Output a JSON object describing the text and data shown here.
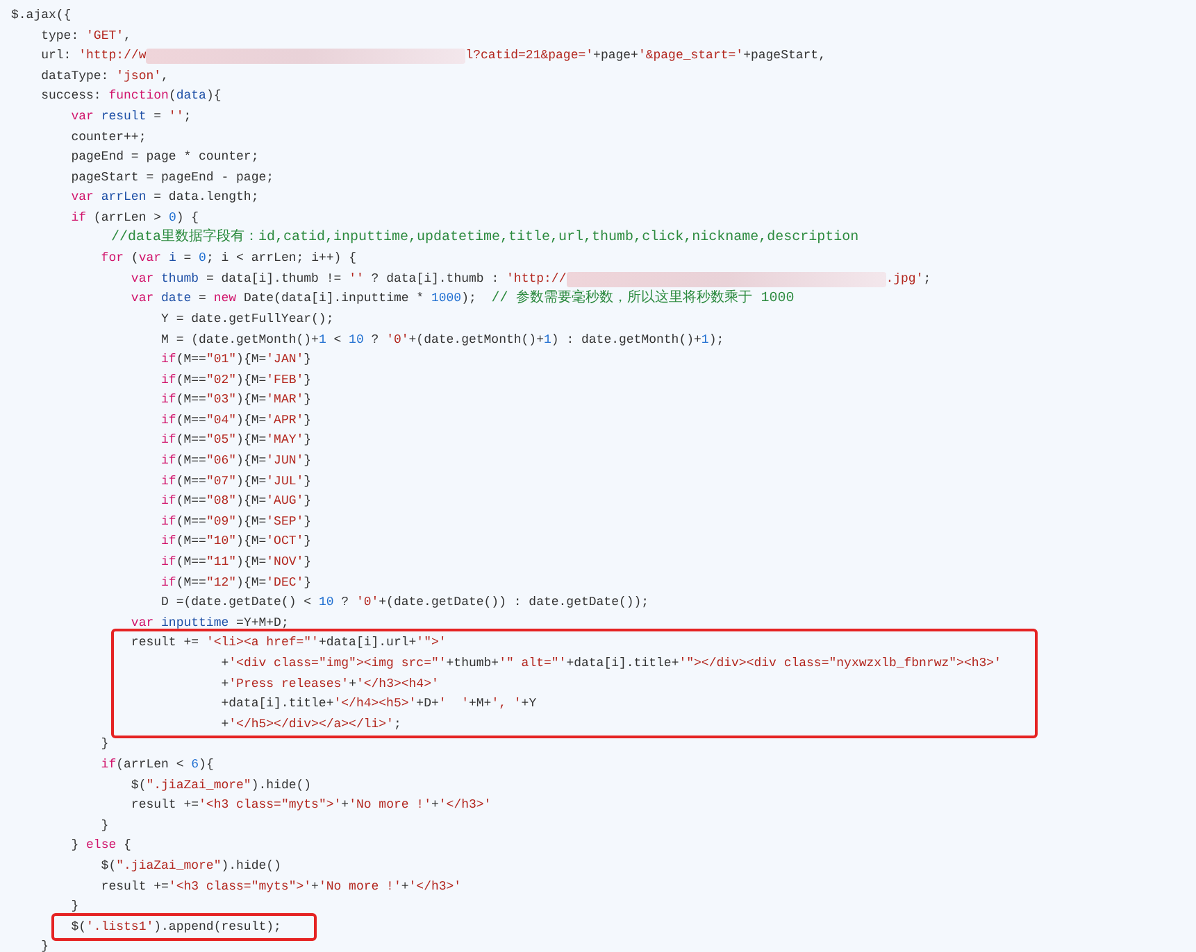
{
  "blocks": [
    {
      "highlighted": false,
      "lines": [
        [
          {
            "kind": "plain",
            "text": "$.ajax({"
          }
        ],
        [
          {
            "kind": "plain",
            "text": "    type: "
          },
          {
            "kind": "string",
            "text": "'GET'"
          },
          {
            "kind": "plain",
            "text": ","
          }
        ],
        [
          {
            "kind": "plain",
            "text": "    url: "
          },
          {
            "kind": "string",
            "text": "'http://w"
          },
          {
            "kind": "redacted"
          },
          {
            "kind": "string",
            "text": "l?catid=21&page='"
          },
          {
            "kind": "plain",
            "text": "+page+"
          },
          {
            "kind": "string",
            "text": "'&page_start='"
          },
          {
            "kind": "plain",
            "text": "+pageStart,"
          }
        ],
        [
          {
            "kind": "plain",
            "text": "    dataType: "
          },
          {
            "kind": "string",
            "text": "'json'"
          },
          {
            "kind": "plain",
            "text": ","
          }
        ],
        [
          {
            "kind": "plain",
            "text": "    success: "
          },
          {
            "kind": "keyword",
            "text": "function"
          },
          {
            "kind": "plain",
            "text": "("
          },
          {
            "kind": "name",
            "text": "data"
          },
          {
            "kind": "plain",
            "text": "){"
          }
        ],
        [
          {
            "kind": "keyword",
            "text": "        var "
          },
          {
            "kind": "name",
            "text": "result"
          },
          {
            "kind": "plain",
            "text": " = "
          },
          {
            "kind": "string",
            "text": "''"
          },
          {
            "kind": "plain",
            "text": ";"
          }
        ],
        [
          {
            "kind": "plain",
            "text": "        counter++;"
          }
        ],
        [
          {
            "kind": "plain",
            "text": "        pageEnd = page * counter;"
          }
        ],
        [
          {
            "kind": "plain",
            "text": "        pageStart = pageEnd - page;"
          }
        ],
        [
          {
            "kind": "keyword",
            "text": "        var "
          },
          {
            "kind": "name",
            "text": "arrLen"
          },
          {
            "kind": "plain",
            "text": " = data.length;"
          }
        ],
        [
          {
            "kind": "keyword",
            "text": "        if"
          },
          {
            "kind": "plain",
            "text": " (arrLen > "
          },
          {
            "kind": "number",
            "text": "0"
          },
          {
            "kind": "plain",
            "text": ") {"
          }
        ],
        [
          {
            "kind": "comment",
            "text": "            //data里数据字段有：id,catid,inputtime,updatetime,title,url,thumb,click,nickname,description"
          }
        ],
        [
          {
            "kind": "keyword",
            "text": "            for"
          },
          {
            "kind": "plain",
            "text": " ("
          },
          {
            "kind": "keyword",
            "text": "var "
          },
          {
            "kind": "name",
            "text": "i"
          },
          {
            "kind": "plain",
            "text": " = "
          },
          {
            "kind": "number",
            "text": "0"
          },
          {
            "kind": "plain",
            "text": "; i < arrLen; i++) {"
          }
        ],
        [
          {
            "kind": "keyword",
            "text": "                var "
          },
          {
            "kind": "name",
            "text": "thumb"
          },
          {
            "kind": "plain",
            "text": " = data[i].thumb != "
          },
          {
            "kind": "string",
            "text": "''"
          },
          {
            "kind": "plain",
            "text": " ? data[i].thumb : "
          },
          {
            "kind": "string",
            "text": "'http://"
          },
          {
            "kind": "redacted"
          },
          {
            "kind": "string",
            "text": ".jpg'"
          },
          {
            "kind": "plain",
            "text": ";"
          }
        ],
        [
          {
            "kind": "keyword",
            "text": "                var "
          },
          {
            "kind": "name",
            "text": "date"
          },
          {
            "kind": "plain",
            "text": " = "
          },
          {
            "kind": "keyword",
            "text": "new"
          },
          {
            "kind": "plain",
            "text": " Date(data[i].inputtime * "
          },
          {
            "kind": "number",
            "text": "1000"
          },
          {
            "kind": "plain",
            "text": ");  "
          },
          {
            "kind": "comment",
            "text": "// 参数需要毫秒数，所以这里将秒数乘于 1000"
          }
        ],
        [
          {
            "kind": "plain",
            "text": "                    Y = date.getFullYear();"
          }
        ],
        [
          {
            "kind": "plain",
            "text": "                    M = (date.getMonth()+"
          },
          {
            "kind": "number",
            "text": "1"
          },
          {
            "kind": "plain",
            "text": " < "
          },
          {
            "kind": "number",
            "text": "10"
          },
          {
            "kind": "plain",
            "text": " ? "
          },
          {
            "kind": "string",
            "text": "'0'"
          },
          {
            "kind": "plain",
            "text": "+(date.getMonth()+"
          },
          {
            "kind": "number",
            "text": "1"
          },
          {
            "kind": "plain",
            "text": ") : date.getMonth()+"
          },
          {
            "kind": "number",
            "text": "1"
          },
          {
            "kind": "plain",
            "text": ");"
          }
        ],
        [
          {
            "kind": "keyword",
            "text": "                    if"
          },
          {
            "kind": "plain",
            "text": "(M=="
          },
          {
            "kind": "string",
            "text": "\"01\""
          },
          {
            "kind": "plain",
            "text": "){M="
          },
          {
            "kind": "string",
            "text": "'JAN'"
          },
          {
            "kind": "plain",
            "text": "}"
          }
        ],
        [
          {
            "kind": "keyword",
            "text": "                    if"
          },
          {
            "kind": "plain",
            "text": "(M=="
          },
          {
            "kind": "string",
            "text": "\"02\""
          },
          {
            "kind": "plain",
            "text": "){M="
          },
          {
            "kind": "string",
            "text": "'FEB'"
          },
          {
            "kind": "plain",
            "text": "}"
          }
        ],
        [
          {
            "kind": "keyword",
            "text": "                    if"
          },
          {
            "kind": "plain",
            "text": "(M=="
          },
          {
            "kind": "string",
            "text": "\"03\""
          },
          {
            "kind": "plain",
            "text": "){M="
          },
          {
            "kind": "string",
            "text": "'MAR'"
          },
          {
            "kind": "plain",
            "text": "}"
          }
        ],
        [
          {
            "kind": "keyword",
            "text": "                    if"
          },
          {
            "kind": "plain",
            "text": "(M=="
          },
          {
            "kind": "string",
            "text": "\"04\""
          },
          {
            "kind": "plain",
            "text": "){M="
          },
          {
            "kind": "string",
            "text": "'APR'"
          },
          {
            "kind": "plain",
            "text": "}"
          }
        ],
        [
          {
            "kind": "keyword",
            "text": "                    if"
          },
          {
            "kind": "plain",
            "text": "(M=="
          },
          {
            "kind": "string",
            "text": "\"05\""
          },
          {
            "kind": "plain",
            "text": "){M="
          },
          {
            "kind": "string",
            "text": "'MAY'"
          },
          {
            "kind": "plain",
            "text": "}"
          }
        ],
        [
          {
            "kind": "keyword",
            "text": "                    if"
          },
          {
            "kind": "plain",
            "text": "(M=="
          },
          {
            "kind": "string",
            "text": "\"06\""
          },
          {
            "kind": "plain",
            "text": "){M="
          },
          {
            "kind": "string",
            "text": "'JUN'"
          },
          {
            "kind": "plain",
            "text": "}"
          }
        ],
        [
          {
            "kind": "keyword",
            "text": "                    if"
          },
          {
            "kind": "plain",
            "text": "(M=="
          },
          {
            "kind": "string",
            "text": "\"07\""
          },
          {
            "kind": "plain",
            "text": "){M="
          },
          {
            "kind": "string",
            "text": "'JUL'"
          },
          {
            "kind": "plain",
            "text": "}"
          }
        ],
        [
          {
            "kind": "keyword",
            "text": "                    if"
          },
          {
            "kind": "plain",
            "text": "(M=="
          },
          {
            "kind": "string",
            "text": "\"08\""
          },
          {
            "kind": "plain",
            "text": "){M="
          },
          {
            "kind": "string",
            "text": "'AUG'"
          },
          {
            "kind": "plain",
            "text": "}"
          }
        ],
        [
          {
            "kind": "keyword",
            "text": "                    if"
          },
          {
            "kind": "plain",
            "text": "(M=="
          },
          {
            "kind": "string",
            "text": "\"09\""
          },
          {
            "kind": "plain",
            "text": "){M="
          },
          {
            "kind": "string",
            "text": "'SEP'"
          },
          {
            "kind": "plain",
            "text": "}"
          }
        ],
        [
          {
            "kind": "keyword",
            "text": "                    if"
          },
          {
            "kind": "plain",
            "text": "(M=="
          },
          {
            "kind": "string",
            "text": "\"10\""
          },
          {
            "kind": "plain",
            "text": "){M="
          },
          {
            "kind": "string",
            "text": "'OCT'"
          },
          {
            "kind": "plain",
            "text": "}"
          }
        ],
        [
          {
            "kind": "keyword",
            "text": "                    if"
          },
          {
            "kind": "plain",
            "text": "(M=="
          },
          {
            "kind": "string",
            "text": "\"11\""
          },
          {
            "kind": "plain",
            "text": "){M="
          },
          {
            "kind": "string",
            "text": "'NOV'"
          },
          {
            "kind": "plain",
            "text": "}"
          }
        ],
        [
          {
            "kind": "keyword",
            "text": "                    if"
          },
          {
            "kind": "plain",
            "text": "(M=="
          },
          {
            "kind": "string",
            "text": "\"12\""
          },
          {
            "kind": "plain",
            "text": "){M="
          },
          {
            "kind": "string",
            "text": "'DEC'"
          },
          {
            "kind": "plain",
            "text": "}"
          }
        ],
        [
          {
            "kind": "plain",
            "text": "                    D =(date.getDate() < "
          },
          {
            "kind": "number",
            "text": "10"
          },
          {
            "kind": "plain",
            "text": " ? "
          },
          {
            "kind": "string",
            "text": "'0'"
          },
          {
            "kind": "plain",
            "text": "+(date.getDate()) : date.getDate());"
          }
        ],
        [
          {
            "kind": "keyword",
            "text": "                var "
          },
          {
            "kind": "name",
            "text": "inputtime"
          },
          {
            "kind": "plain",
            "text": " =Y+M+D;"
          }
        ]
      ]
    },
    {
      "highlighted": true,
      "lines": [
        [
          {
            "kind": "plain",
            "text": "                result += "
          },
          {
            "kind": "string",
            "text": "'<li><a href=\"'"
          },
          {
            "kind": "plain",
            "text": "+data[i].url+"
          },
          {
            "kind": "string",
            "text": "'\">'"
          }
        ],
        [
          {
            "kind": "plain",
            "text": "                            +"
          },
          {
            "kind": "string",
            "text": "'<div class=\"img\"><img src=\"'"
          },
          {
            "kind": "plain",
            "text": "+thumb+"
          },
          {
            "kind": "string",
            "text": "'\" alt=\"'"
          },
          {
            "kind": "plain",
            "text": "+data[i].title+"
          },
          {
            "kind": "string",
            "text": "'\"></div><div class=\"nyxwzxlb_fbnrwz\"><h3>'"
          }
        ],
        [
          {
            "kind": "plain",
            "text": "                            +"
          },
          {
            "kind": "string",
            "text": "'Press releases'"
          },
          {
            "kind": "plain",
            "text": "+"
          },
          {
            "kind": "string",
            "text": "'</h3><h4>'"
          }
        ],
        [
          {
            "kind": "plain",
            "text": "                            +data[i].title+"
          },
          {
            "kind": "string",
            "text": "'</h4><h5>'"
          },
          {
            "kind": "plain",
            "text": "+D+"
          },
          {
            "kind": "string",
            "text": "'  '"
          },
          {
            "kind": "plain",
            "text": "+M+"
          },
          {
            "kind": "string",
            "text": "', '"
          },
          {
            "kind": "plain",
            "text": "+Y"
          }
        ],
        [
          {
            "kind": "plain",
            "text": "                            +"
          },
          {
            "kind": "string",
            "text": "'</h5></div></a></li>'"
          },
          {
            "kind": "plain",
            "text": ";"
          }
        ]
      ]
    },
    {
      "highlighted": false,
      "lines": [
        [
          {
            "kind": "plain",
            "text": "            }"
          }
        ],
        [
          {
            "kind": "keyword",
            "text": "            if"
          },
          {
            "kind": "plain",
            "text": "(arrLen < "
          },
          {
            "kind": "number",
            "text": "6"
          },
          {
            "kind": "plain",
            "text": "){"
          }
        ],
        [
          {
            "kind": "plain",
            "text": "                $("
          },
          {
            "kind": "string",
            "text": "\".jiaZai_more\""
          },
          {
            "kind": "plain",
            "text": ").hide()"
          }
        ],
        [
          {
            "kind": "plain",
            "text": "                result +="
          },
          {
            "kind": "string",
            "text": "'<h3 class=\"myts\">'"
          },
          {
            "kind": "plain",
            "text": "+"
          },
          {
            "kind": "string",
            "text": "'No more !'"
          },
          {
            "kind": "plain",
            "text": "+"
          },
          {
            "kind": "string",
            "text": "'</h3>'"
          }
        ],
        [
          {
            "kind": "plain",
            "text": "            }"
          }
        ],
        [
          {
            "kind": "plain",
            "text": "        } "
          },
          {
            "kind": "keyword",
            "text": "else"
          },
          {
            "kind": "plain",
            "text": " {"
          }
        ],
        [
          {
            "kind": "plain",
            "text": "            $("
          },
          {
            "kind": "string",
            "text": "\".jiaZai_more\""
          },
          {
            "kind": "plain",
            "text": ").hide()"
          }
        ],
        [
          {
            "kind": "plain",
            "text": "            result +="
          },
          {
            "kind": "string",
            "text": "'<h3 class=\"myts\">'"
          },
          {
            "kind": "plain",
            "text": "+"
          },
          {
            "kind": "string",
            "text": "'No more !'"
          },
          {
            "kind": "plain",
            "text": "+"
          },
          {
            "kind": "string",
            "text": "'</h3>'"
          }
        ],
        [
          {
            "kind": "plain",
            "text": "        }"
          }
        ]
      ]
    },
    {
      "highlighted": true,
      "lines": [
        [
          {
            "kind": "plain",
            "text": "        $("
          },
          {
            "kind": "string",
            "text": "'.lists1'"
          },
          {
            "kind": "plain",
            "text": ").append(result);"
          }
        ]
      ]
    },
    {
      "highlighted": false,
      "lines": [
        [
          {
            "kind": "plain",
            "text": "    }"
          }
        ]
      ]
    }
  ]
}
